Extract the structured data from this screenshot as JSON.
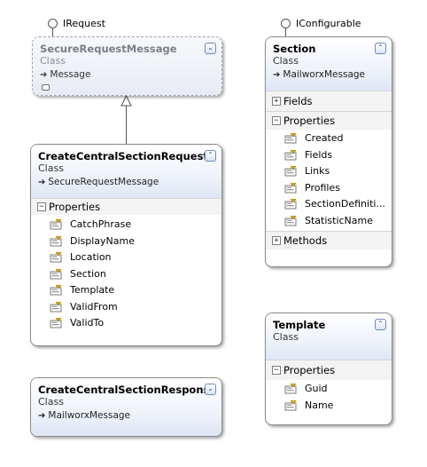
{
  "interfaces": {
    "irequest": "IRequest",
    "iconfigurable": "IConfigurable"
  },
  "classes": {
    "secure_request_message": {
      "title": "SecureRequestMessage",
      "kind": "Class",
      "base": "Message"
    },
    "create_central_section_request": {
      "title": "CreateCentralSectionRequest",
      "kind": "Class",
      "base": "SecureRequestMessage",
      "sections": {
        "properties": "Properties"
      },
      "properties": [
        "CatchPhrase",
        "DisplayName",
        "Location",
        "Section",
        "Template",
        "ValidFrom",
        "ValidTo"
      ]
    },
    "create_central_section_response": {
      "title": "CreateCentralSectionResponse",
      "kind": "Class",
      "base": "MailworxMessage"
    },
    "section": {
      "title": "Section",
      "kind": "Class",
      "base": "MailworxMessage",
      "sections": {
        "fields": "Fields",
        "properties": "Properties",
        "methods": "Methods"
      },
      "properties": [
        "Created",
        "Fields",
        "Links",
        "Profiles",
        "SectionDefiniti...",
        "StatisticName"
      ]
    },
    "template": {
      "title": "Template",
      "kind": "Class",
      "sections": {
        "properties": "Properties"
      },
      "properties": [
        "Guid",
        "Name"
      ]
    }
  },
  "glyphs": {
    "collapse": "⊗",
    "expand_double_down": "⌄",
    "minus": "−",
    "plus": "+",
    "inherit_arrow": "➔"
  }
}
